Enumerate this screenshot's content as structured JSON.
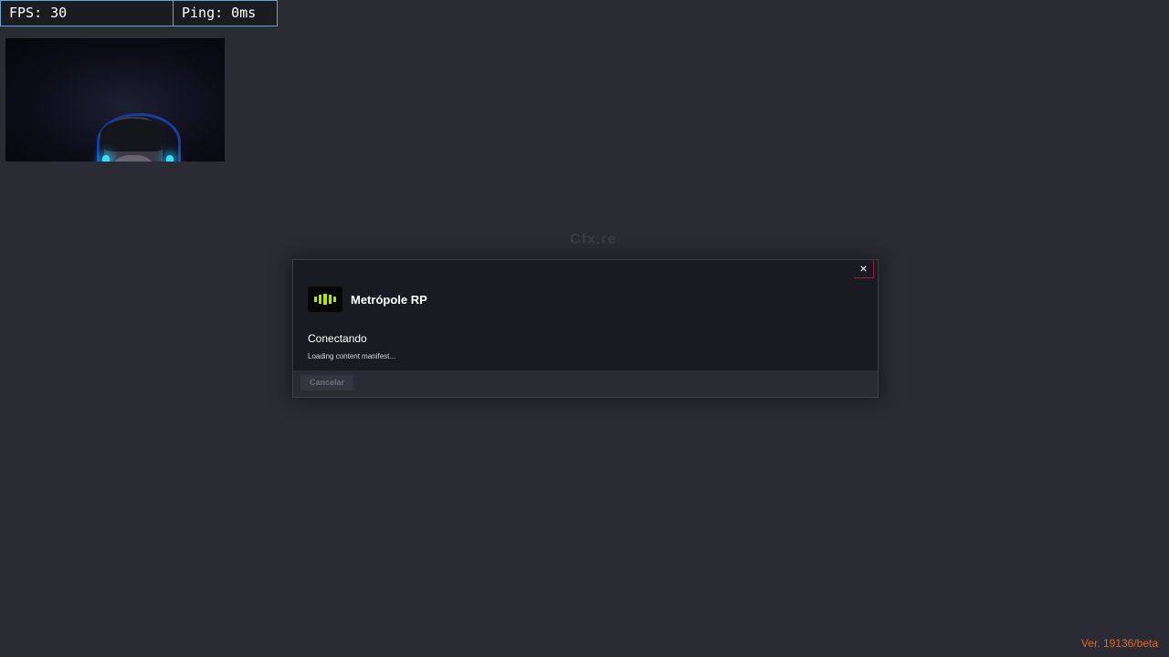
{
  "overlay": {
    "fps_text": "FPS: 30",
    "ping_text": "Ping: 0ms"
  },
  "background": {
    "logo_text": "Cfx.re"
  },
  "dialog": {
    "close_label": "×",
    "server_name": "Metrópole RP",
    "status_title": "Conectando",
    "status_detail": "Loading content manifest...",
    "cancel_label": "Cancelar"
  },
  "footer": {
    "version": "Ver. 19136/beta"
  },
  "colors": {
    "background": "#2a2b33",
    "dialog": "#191a22",
    "stat_border": "#5aa8d8",
    "version_text": "#e0672a",
    "logo_accent": "#b6e400",
    "close_border": "#9a1f3a"
  }
}
